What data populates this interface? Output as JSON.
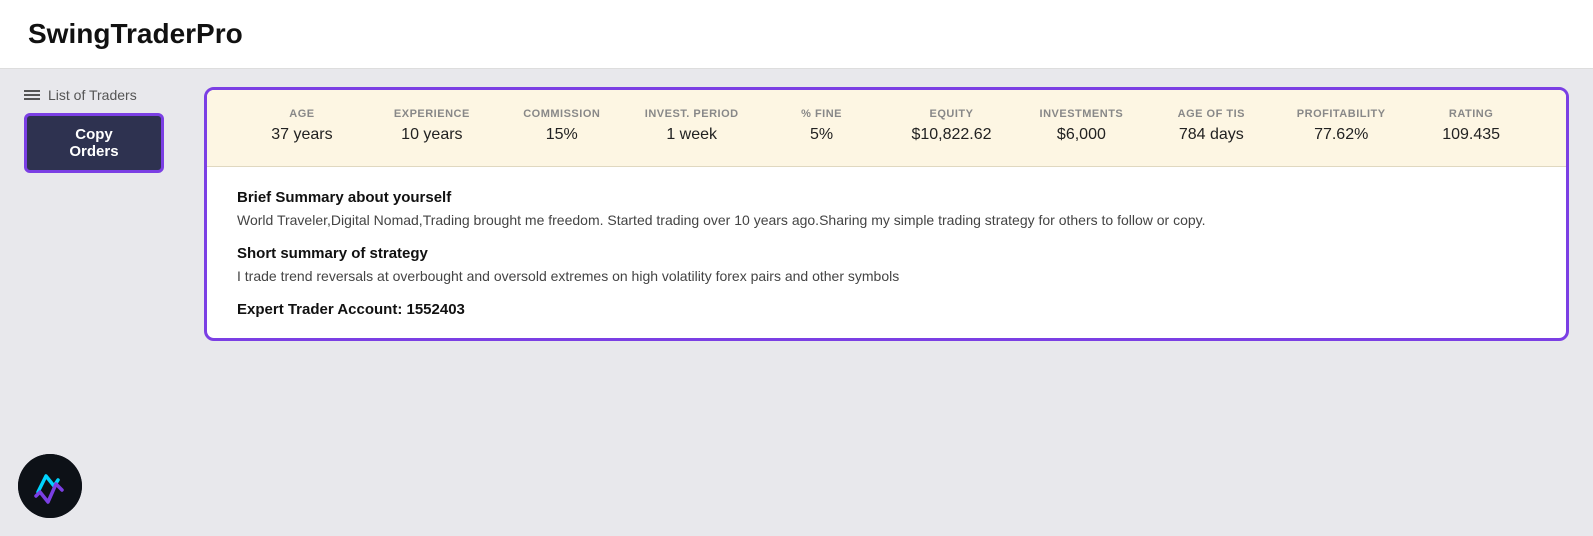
{
  "app": {
    "title": "SwingTraderPro"
  },
  "left_panel": {
    "list_of_traders_label": "List of Traders",
    "copy_orders_btn": "Copy Orders"
  },
  "stats": {
    "columns": [
      {
        "label": "AGE",
        "value": "37 years",
        "extra": ""
      },
      {
        "label": "EXPERIENCE",
        "value": "10 years",
        "extra": ""
      },
      {
        "label": "COMMISSION",
        "value": "15%",
        "extra": ""
      },
      {
        "label": "INVEST. PERIOD",
        "value": "1 week",
        "extra": ""
      },
      {
        "label": "% FINE",
        "value": "5%",
        "extra": ""
      },
      {
        "label": "EQUITY",
        "value": "$10,822.62",
        "extra": ""
      },
      {
        "label": "INVESTMENTS",
        "value": "$6,000",
        "extra": ""
      },
      {
        "label": "AGE OF TIS",
        "value": "784 days",
        "extra": ""
      },
      {
        "label": "PROFITABILITY",
        "value": "77.62%",
        "extra": ""
      },
      {
        "label": "RATING",
        "value": "109.435",
        "extra": ""
      }
    ]
  },
  "details": {
    "summary_title": "Brief Summary about yourself",
    "summary_text": "World Traveler,Digital Nomad,Trading brought me freedom. Started trading over 10 years ago.Sharing my simple trading strategy for others to follow or copy.",
    "strategy_title": "Short summary of strategy",
    "strategy_text": "I trade trend reversals at overbought and oversold extremes on high volatility forex pairs and other symbols",
    "account_title": "Expert Trader Account: 1552403"
  }
}
